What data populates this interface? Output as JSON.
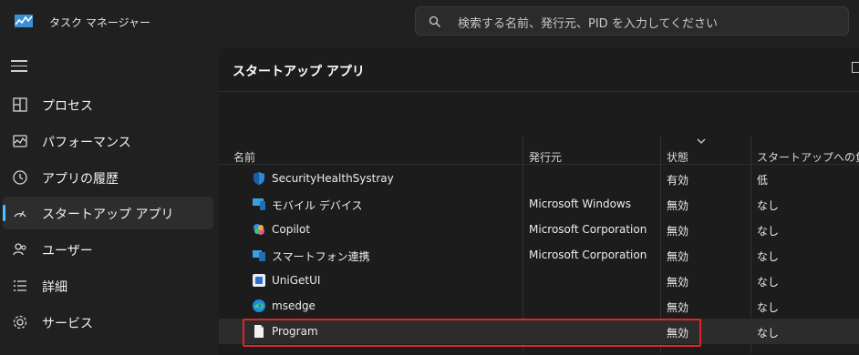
{
  "app": {
    "title": "タスク マネージャー"
  },
  "search": {
    "placeholder": "検索する名前、発行元、PID を入力してください"
  },
  "sidebar": {
    "items": [
      {
        "label": "プロセス",
        "icon": "processes-icon"
      },
      {
        "label": "パフォーマンス",
        "icon": "performance-icon"
      },
      {
        "label": "アプリの履歴",
        "icon": "app-history-icon"
      },
      {
        "label": "スタートアップ アプリ",
        "icon": "startup-apps-icon",
        "active": true
      },
      {
        "label": "ユーザー",
        "icon": "users-icon"
      },
      {
        "label": "詳細",
        "icon": "details-icon"
      },
      {
        "label": "サービス",
        "icon": "services-icon"
      }
    ]
  },
  "main": {
    "title": "スタートアップ アプリ",
    "columns": [
      "名前",
      "発行元",
      "状態",
      "スタートアップへの負荷"
    ],
    "rows": [
      {
        "name": "SecurityHealthSystray",
        "publisher": "",
        "status": "有効",
        "impact": "低",
        "icon": "windows-security-icon"
      },
      {
        "name": "モバイル デバイス",
        "publisher": "Microsoft Windows",
        "status": "無効",
        "impact": "なし",
        "icon": "mobile-devices-icon"
      },
      {
        "name": "Copilot",
        "publisher": "Microsoft Corporation",
        "status": "無効",
        "impact": "なし",
        "icon": "copilot-icon"
      },
      {
        "name": "スマートフォン連携",
        "publisher": "Microsoft Corporation",
        "status": "無効",
        "impact": "なし",
        "icon": "phone-link-icon"
      },
      {
        "name": "UniGetUI",
        "publisher": "",
        "status": "無効",
        "impact": "なし",
        "icon": "unigetui-icon"
      },
      {
        "name": "msedge",
        "publisher": "",
        "status": "無効",
        "impact": "なし",
        "icon": "edge-icon"
      },
      {
        "name": "Program",
        "publisher": "",
        "status": "無効",
        "impact": "なし",
        "icon": "generic-file-icon",
        "selected": true
      }
    ]
  },
  "colors": {
    "accent": "#4cc2ff",
    "highlight_box": "#e0242a",
    "background": "#202020"
  }
}
